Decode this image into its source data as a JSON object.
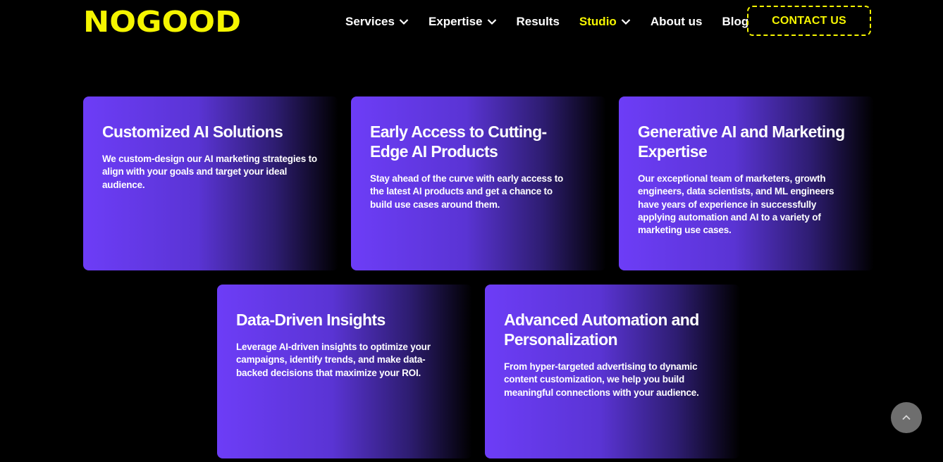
{
  "header": {
    "logo_text": "NOGOOD",
    "nav": [
      {
        "label": "Services",
        "has_dropdown": true,
        "active": false
      },
      {
        "label": "Expertise",
        "has_dropdown": true,
        "active": false
      },
      {
        "label": "Results",
        "has_dropdown": false,
        "active": false
      },
      {
        "label": "Studio",
        "has_dropdown": true,
        "active": true
      },
      {
        "label": "About us",
        "has_dropdown": false,
        "active": false
      },
      {
        "label": "Blog",
        "has_dropdown": false,
        "active": false
      }
    ],
    "contact_label": "CONTACT US"
  },
  "cards": [
    {
      "title": "Customized AI Solutions",
      "description": "We custom-design our AI marketing strategies to align with your goals and target your ideal audience."
    },
    {
      "title": "Early Access to Cutting-Edge AI Products",
      "description": "Stay ahead of the curve with early access to the latest AI products and get a chance to build use cases around them."
    },
    {
      "title": "Generative AI and Marketing Expertise",
      "description": "Our exceptional team of marketers, growth engineers, data scientists, and ML engineers have years of experience in successfully applying automation and AI to a variety of marketing use cases."
    },
    {
      "title": "Data-Driven Insights",
      "description": "Leverage AI-driven insights to optimize your campaigns, identify trends, and make data-backed decisions that maximize your ROI."
    },
    {
      "title": "Advanced Automation and Personalization",
      "description": "From hyper-targeted advertising to dynamic content customization, we help you build meaningful connections with your audience."
    }
  ],
  "colors": {
    "background": "#000000",
    "accent_yellow": "#f5f500",
    "card_purple": "#6d3df7",
    "scroll_button": "#6e6e6e"
  },
  "icons": {
    "dropdown": "chevron-down-icon",
    "scroll_top": "chevron-up-icon"
  }
}
